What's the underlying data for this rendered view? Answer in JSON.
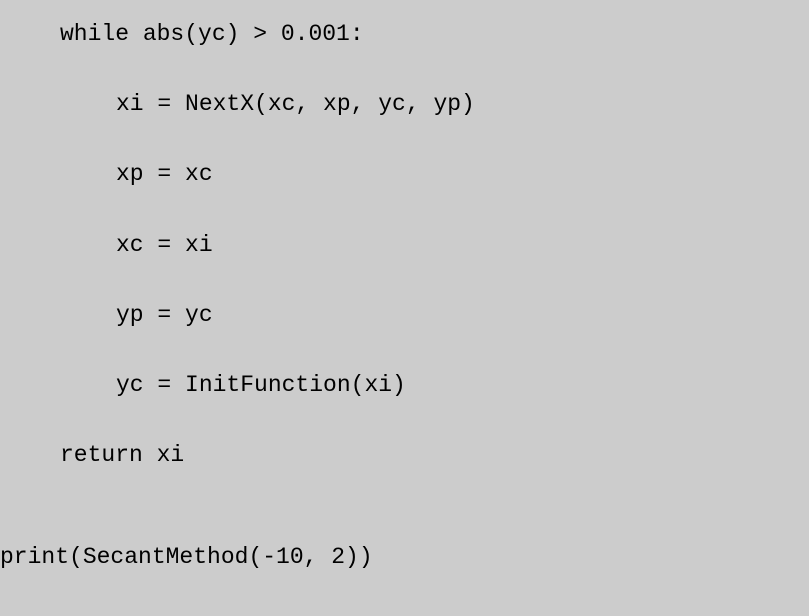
{
  "code": {
    "line1": "while abs(yc) > 0.001:",
    "line2": "xi = NextX(xc, xp, yc, yp)",
    "line3": "xp = xc",
    "line4": "xc = xi",
    "line5": "yp = yc",
    "line6": "yc = InitFunction(xi)",
    "line7": "return xi",
    "line8": "print(SecantMethod(-10, 2))"
  }
}
